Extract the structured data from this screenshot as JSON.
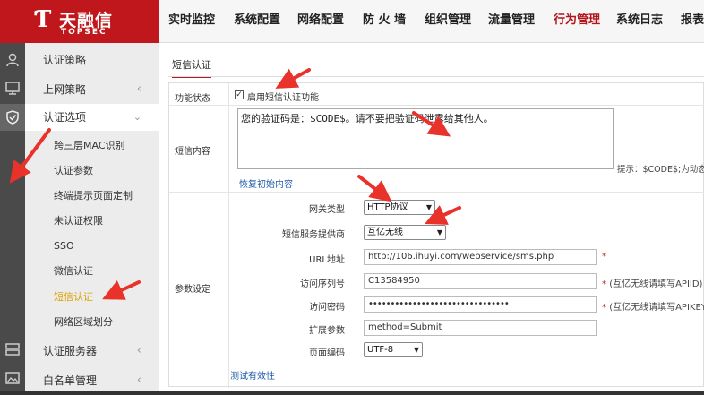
{
  "brand": {
    "mark": "Ƭ",
    "name": "天融信",
    "sub": "TOPSEC",
    "color": "#c0171c"
  },
  "nav": {
    "items": [
      {
        "label": "实时监控"
      },
      {
        "label": "系统配置"
      },
      {
        "label": "网络配置"
      },
      {
        "label": "防 火 墙"
      },
      {
        "label": "组织管理"
      },
      {
        "label": "流量管理"
      },
      {
        "label": "行为管理"
      },
      {
        "label": "系统日志"
      },
      {
        "label": "报表"
      }
    ],
    "active_index": 6
  },
  "rail": {
    "icons": [
      "user-icon",
      "monitor-icon",
      "shield-icon",
      "server-icon",
      "image-icon"
    ]
  },
  "menu": {
    "items": [
      {
        "label": "认证策略"
      },
      {
        "label": "上网策略"
      },
      {
        "label": "认证选项"
      },
      {
        "label": "认证服务器"
      },
      {
        "label": "白名单管理"
      }
    ],
    "submenu": [
      {
        "label": "跨三层MAC识别"
      },
      {
        "label": "认证参数"
      },
      {
        "label": "终端提示页面定制"
      },
      {
        "label": "未认证权限"
      },
      {
        "label": "SSO"
      },
      {
        "label": "微信认证"
      },
      {
        "label": "短信认证"
      },
      {
        "label": "网络区域划分"
      }
    ]
  },
  "main": {
    "tab": "短信认证",
    "status": {
      "label": "功能状态",
      "checkbox_label": "启用短信认证功能",
      "checked": true
    },
    "content": {
      "label": "短信内容",
      "text": "您的验证码是：$CODE$。请不要把验证码泄露给其他人。",
      "hint": "提示：$CODE$;为动态验",
      "restore_link": "恢复初始内容"
    },
    "params": {
      "label": "参数设定",
      "gateway_type": {
        "label": "网关类型",
        "value": "HTTP协议"
      },
      "provider": {
        "label": "短信服务提供商",
        "value": "互亿无线"
      },
      "url": {
        "label": "URL地址",
        "value": "http://106.ihuyi.com/webservice/sms.php",
        "note": "*"
      },
      "serial": {
        "label": "访问序列号",
        "value": "C13584950",
        "note": "(互亿无线请填写APIID)"
      },
      "password": {
        "label": "访问密码",
        "value": "••••••••••••••••••••••••••••••••",
        "note": "(互亿无线请填写APIKEY"
      },
      "ext_params": {
        "label": "扩展参数",
        "value": "method=Submit"
      },
      "encoding": {
        "label": "页面编码",
        "value": "UTF-8"
      },
      "test_link": "测试有效性"
    }
  },
  "annotations": {
    "arrow_color": "#e8322a"
  }
}
